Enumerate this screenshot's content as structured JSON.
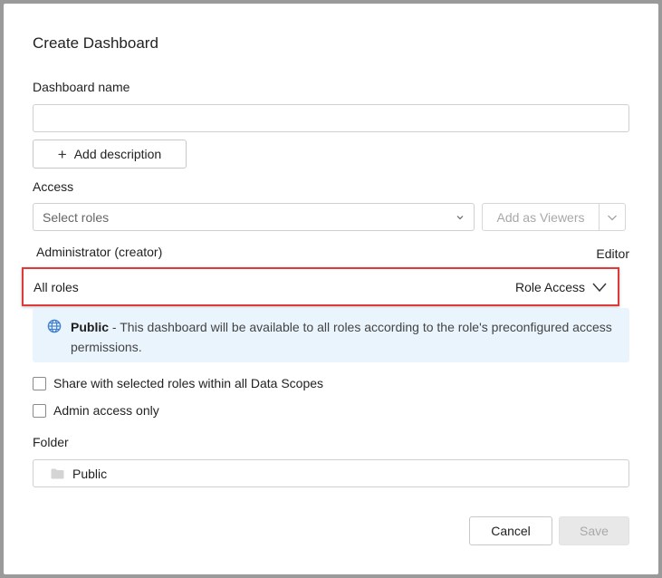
{
  "dialog": {
    "title": "Create Dashboard"
  },
  "name_field": {
    "label": "Dashboard name",
    "value": "",
    "placeholder": ""
  },
  "add_description_label": "Add description",
  "access": {
    "label": "Access",
    "select_placeholder": "Select roles",
    "add_button_label": "Add as Viewers",
    "creator_name": "Administrator (creator)",
    "creator_role": "Editor",
    "all_roles_label": "All roles",
    "role_access_label": "Role Access"
  },
  "info": {
    "title": "Public",
    "text": " - This dashboard will be available to all roles according to the role's preconfigured access permissions.",
    "icon": "globe-icon",
    "icon_color": "#3f7fd0"
  },
  "checkboxes": {
    "share_label": "Share with selected roles within all Data Scopes",
    "admin_label": "Admin access only"
  },
  "folder": {
    "label": "Folder",
    "value": "Public"
  },
  "footer": {
    "cancel_label": "Cancel",
    "save_label": "Save"
  },
  "colors": {
    "highlight_border": "#dd3b3b",
    "info_background": "#eaf4fd"
  }
}
